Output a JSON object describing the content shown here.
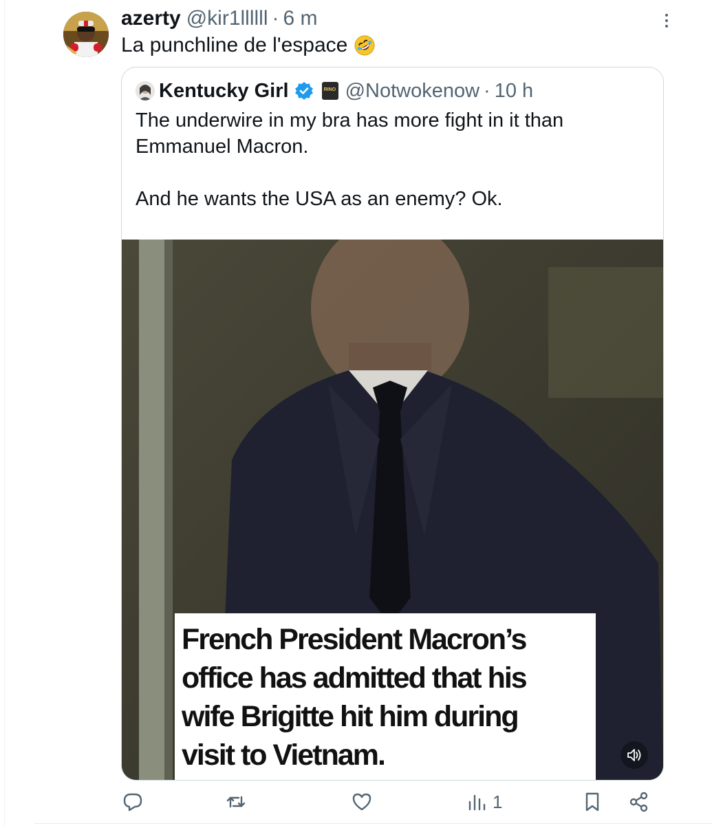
{
  "tweet": {
    "display_name": "azerty",
    "handle": "@kir1llllll",
    "separator": "·",
    "time": "6 m",
    "text": "La punchline de l'espace",
    "emoji_icon": "rofl-emoji-icon"
  },
  "quoted_tweet": {
    "display_name": "Kentucky Girl",
    "handle": "@Notwokenow",
    "separator": "·",
    "time": "10 h",
    "text": "The underwire in my bra has more fight in it than Emmanuel Macron.\n\nAnd he wants the USA as an enemy? Ok.",
    "video_caption_lines": [
      "French President Macron’s",
      "office has admitted that his",
      "wife Brigitte hit him during",
      "visit to Vietnam."
    ]
  },
  "actions": {
    "reply_icon": "reply-icon",
    "repost_icon": "repost-icon",
    "like_icon": "like-icon",
    "views_icon": "views-icon",
    "views_count": "1",
    "bookmark_icon": "bookmark-icon",
    "share_icon": "share-icon"
  },
  "colors": {
    "secondary_text": "#536471",
    "verified_blue": "#1d9bf0",
    "border": "#cfd9de"
  }
}
